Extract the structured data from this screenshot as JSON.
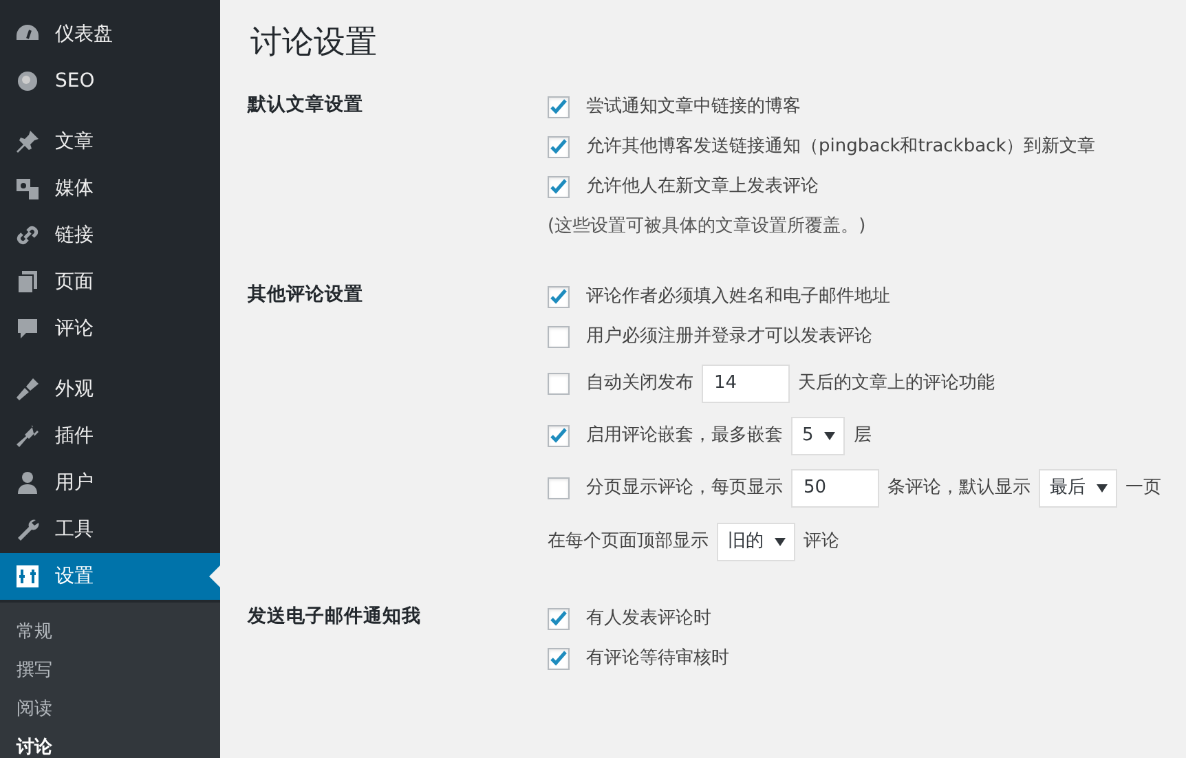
{
  "sidebar": {
    "groups": [
      [
        {
          "label": "仪表盘",
          "selected": false
        },
        {
          "label": "SEO",
          "selected": false
        }
      ],
      [
        {
          "label": "文章",
          "selected": false
        },
        {
          "label": "媒体",
          "selected": false
        },
        {
          "label": "链接",
          "selected": false
        },
        {
          "label": "页面",
          "selected": false
        },
        {
          "label": "评论",
          "selected": false
        }
      ],
      [
        {
          "label": "外观",
          "selected": false
        },
        {
          "label": "插件",
          "selected": false
        },
        {
          "label": "用户",
          "selected": false
        },
        {
          "label": "工具",
          "selected": false
        },
        {
          "label": "设置",
          "selected": true
        }
      ]
    ],
    "submenu": [
      {
        "label": "常规",
        "selected": false
      },
      {
        "label": "撰写",
        "selected": false
      },
      {
        "label": "阅读",
        "selected": false
      },
      {
        "label": "讨论",
        "selected": true
      }
    ]
  },
  "page_title": "讨论设置",
  "sections": [
    {
      "label": "默认文章设置",
      "options": [
        {
          "kind": "checkbox",
          "checked": true,
          "parts": [
            {
              "kind": "text",
              "text": "尝试通知文章中链接的博客"
            }
          ]
        },
        {
          "kind": "checkbox",
          "checked": true,
          "parts": [
            {
              "kind": "text",
              "text": "允许其他博客发送链接通知（pingback和trackback）到新文章"
            }
          ]
        },
        {
          "kind": "checkbox",
          "checked": true,
          "parts": [
            {
              "kind": "text",
              "text": "允许他人在新文章上发表评论"
            }
          ]
        },
        {
          "kind": "note",
          "parts": [
            {
              "kind": "text",
              "text": "(这些设置可被具体的文章设置所覆盖。)"
            }
          ]
        }
      ]
    },
    {
      "label": "其他评论设置",
      "options": [
        {
          "kind": "checkbox",
          "checked": true,
          "parts": [
            {
              "kind": "text",
              "text": "评论作者必须填入姓名和电子邮件地址"
            }
          ]
        },
        {
          "kind": "checkbox",
          "checked": false,
          "parts": [
            {
              "kind": "text",
              "text": "用户必须注册并登录才可以发表评论"
            }
          ]
        },
        {
          "kind": "checkbox",
          "checked": false,
          "parts": [
            {
              "kind": "text",
              "text": "自动关闭发布"
            },
            {
              "kind": "input",
              "value": "14"
            },
            {
              "kind": "text",
              "text": "天后的文章上的评论功能"
            }
          ]
        },
        {
          "kind": "checkbox",
          "checked": true,
          "parts": [
            {
              "kind": "text",
              "text": "启用评论嵌套，最多嵌套"
            },
            {
              "kind": "select",
              "value": "5"
            },
            {
              "kind": "text",
              "text": "层"
            }
          ]
        },
        {
          "kind": "checkbox",
          "checked": false,
          "parts": [
            {
              "kind": "text",
              "text": "分页显示评论，每页显示"
            },
            {
              "kind": "input",
              "value": "50"
            },
            {
              "kind": "text",
              "text": "条评论，默认显示"
            },
            {
              "kind": "select",
              "value": "最后"
            },
            {
              "kind": "text",
              "text": "一页"
            }
          ]
        },
        {
          "kind": "line",
          "parts": [
            {
              "kind": "text",
              "text": "在每个页面顶部显示"
            },
            {
              "kind": "select",
              "value": "旧的"
            },
            {
              "kind": "text",
              "text": "评论"
            }
          ]
        }
      ]
    },
    {
      "label": "发送电子邮件通知我",
      "options": [
        {
          "kind": "checkbox",
          "checked": true,
          "parts": [
            {
              "kind": "text",
              "text": "有人发表评论时"
            }
          ]
        },
        {
          "kind": "checkbox",
          "checked": true,
          "parts": [
            {
              "kind": "text",
              "text": "有评论等待审核时"
            }
          ]
        }
      ]
    }
  ]
}
